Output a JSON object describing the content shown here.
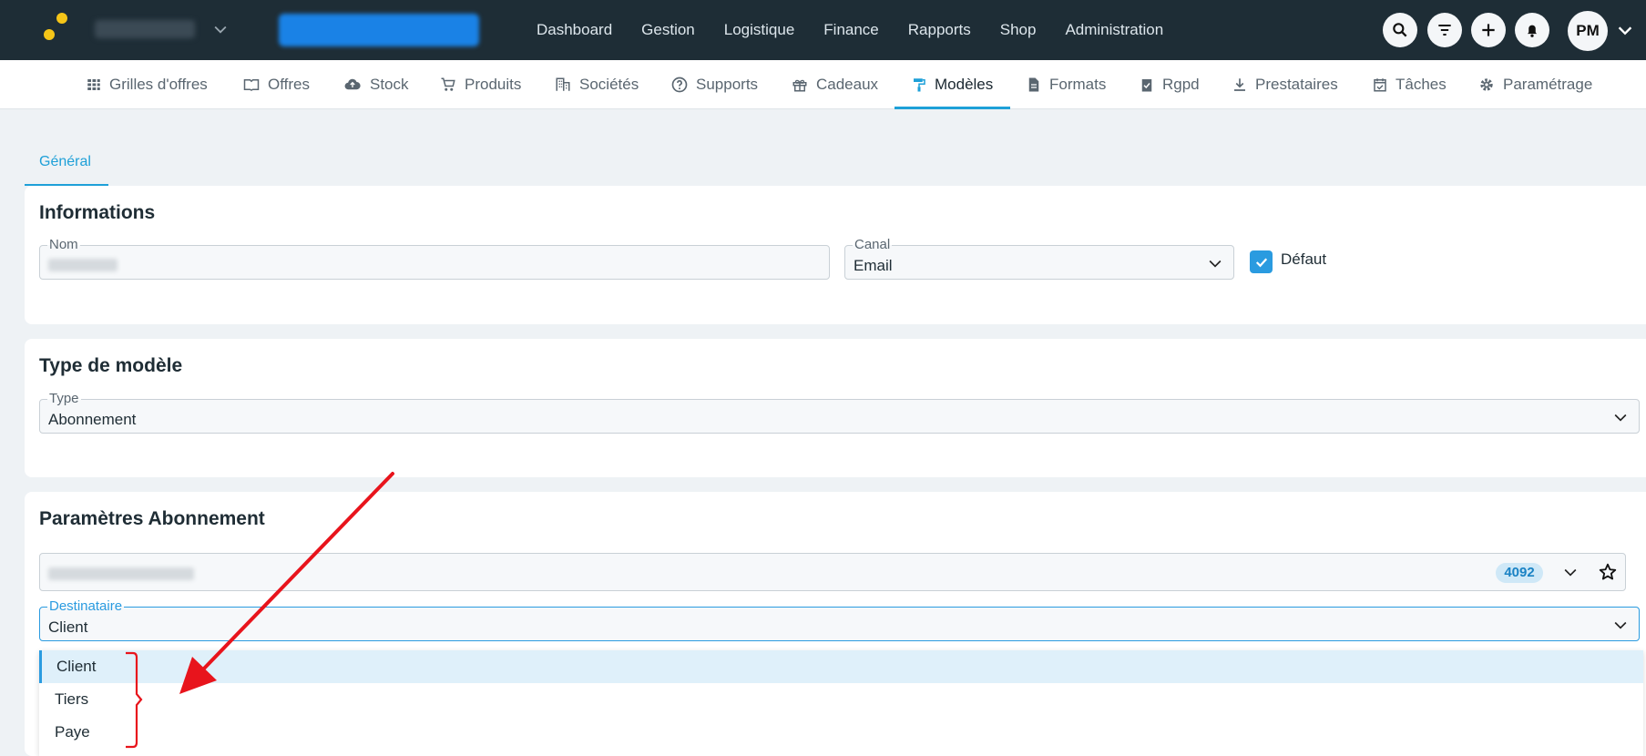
{
  "nav": {
    "items": [
      "Dashboard",
      "Gestion",
      "Logistique",
      "Finance",
      "Rapports",
      "Shop",
      "Administration"
    ],
    "user_initials": "PM"
  },
  "subnav": {
    "items": [
      {
        "label": "Grilles d'offres",
        "icon": "grid-icon"
      },
      {
        "label": "Offres",
        "icon": "book-icon"
      },
      {
        "label": "Stock",
        "icon": "cloud-upload-icon"
      },
      {
        "label": "Produits",
        "icon": "cart-icon"
      },
      {
        "label": "Sociétés",
        "icon": "building-icon"
      },
      {
        "label": "Supports",
        "icon": "help-circle-icon"
      },
      {
        "label": "Cadeaux",
        "icon": "gift-icon"
      },
      {
        "label": "Modèles",
        "icon": "paint-roller-icon"
      },
      {
        "label": "Formats",
        "icon": "document-icon"
      },
      {
        "label": "Rgpd",
        "icon": "clipboard-check-icon"
      },
      {
        "label": "Prestataires",
        "icon": "download-icon"
      },
      {
        "label": "Tâches",
        "icon": "calendar-check-icon"
      },
      {
        "label": "Paramétrage",
        "icon": "gear-icon"
      }
    ],
    "active": "Modèles"
  },
  "tabs": {
    "general": "Général"
  },
  "informations": {
    "title": "Informations",
    "nom_label": "Nom",
    "canal_label": "Canal",
    "canal_value": "Email",
    "defaut_label": "Défaut",
    "defaut_checked": true
  },
  "type_modele": {
    "title": "Type de modèle",
    "type_label": "Type",
    "type_value": "Abonnement"
  },
  "parametres": {
    "title": "Paramètres Abonnement",
    "badge": "4092",
    "destinataire_label": "Destinataire",
    "destinataire_value": "Client",
    "options": [
      "Client",
      "Tiers",
      "Paye"
    ]
  },
  "colors": {
    "navbar": "#1e2d36",
    "accent": "#1ea0d8",
    "annotation": "#e8141c"
  }
}
